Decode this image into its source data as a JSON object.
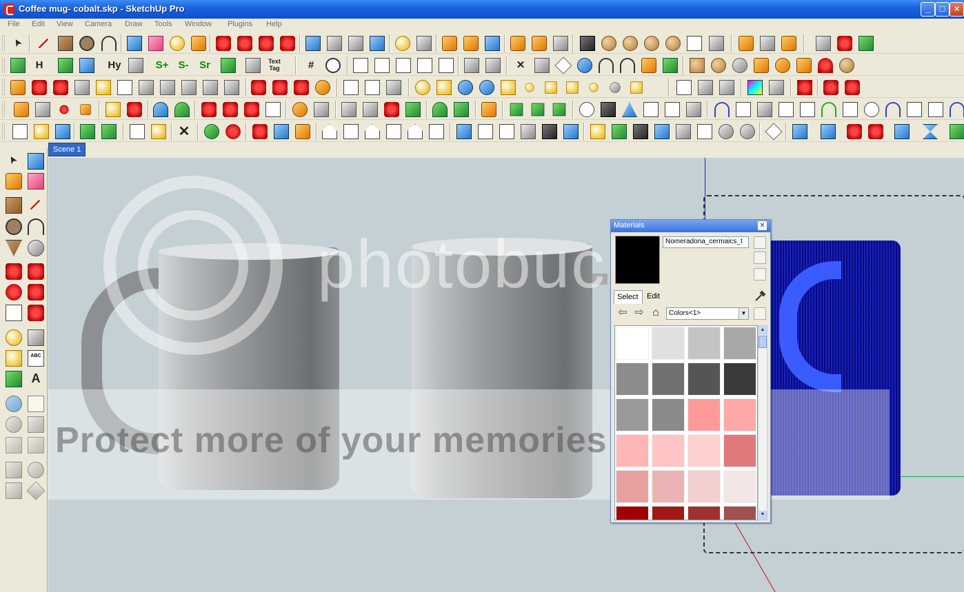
{
  "window": {
    "title": "Coffee mug- cobalt.skp - SketchUp Pro",
    "min_label": "_",
    "max_label": "□",
    "close_label": "×"
  },
  "menu": [
    "File",
    "Edit",
    "View",
    "Camera",
    "Draw",
    "Tools",
    "Window",
    "Plugins",
    "Help"
  ],
  "toolbar_glyphs": {
    "h_axis": "H",
    "hy": "Hy",
    "s_plus": "S+",
    "s_minus": "S-",
    "sr": "Sr",
    "text_tag": "Text Tag",
    "grid": "#"
  },
  "left_toolbar_labels": {
    "abc": "ABC",
    "text_a": "A"
  },
  "scene_tab": "Scene 1",
  "watermark": {
    "top": "photobucket",
    "bottom": "Protect more of your memories for less!"
  },
  "materials": {
    "title": "Materials",
    "close_label": "×",
    "material_name": "Nomeradona_cermaics_t",
    "tabs": [
      "Select",
      "Edit"
    ],
    "collection": "Colors<1>",
    "accent": "#316ac5",
    "swatches": [
      "#ffffff",
      "#e0e0e0",
      "#c4c4c4",
      "#a8a8a8",
      "#8c8c8c",
      "#707070",
      "#555555",
      "#3a3a3a",
      "#9a9a9a",
      "#8a8a8a",
      "#ff9a9a",
      "#ffa8a8",
      "#ffb6b6",
      "#ffc4c4",
      "#ffd0d0",
      "#e07a7a",
      "#e8a0a0",
      "#eab4b4",
      "#f2d0d0",
      "#f4e6e6",
      "#a00000",
      "#a01818",
      "#a03030",
      "#a05050"
    ]
  }
}
